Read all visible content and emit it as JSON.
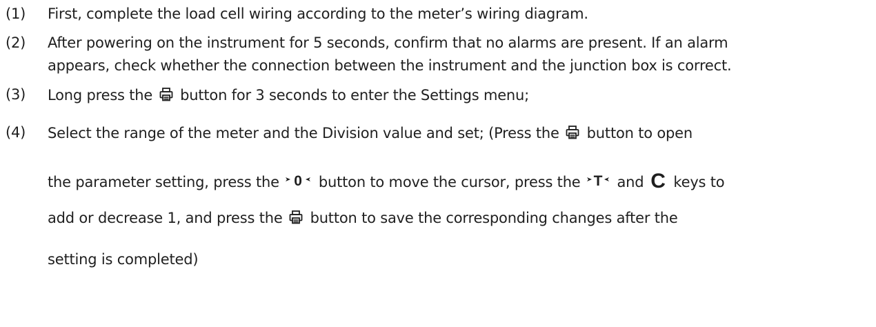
{
  "items": [
    {
      "number": "(1)",
      "text": "First, complete the load cell wiring according to the meter’s wiring diagram."
    },
    {
      "number": "(2)",
      "line1": "After powering on the instrument for 5 seconds, confirm that no alarms are present. If an alarm",
      "line2": "appears, check whether the connection between the instrument and the junction box is correct."
    },
    {
      "number": "(3)",
      "before": "Long press the",
      "after": "button for 3 seconds to enter the Settings menu;"
    },
    {
      "number": "(4)",
      "l1_a": "Select the range of the meter and the Division value and set;  (Press the",
      "l1_b": "button to open",
      "l2_a": "the parameter setting, press the",
      "l2_b": "button to move the cursor, press the",
      "l2_c": "and",
      "l2_d": "keys to",
      "l3_a": "add or decrease 1, and press the",
      "l3_b": "button to save the corresponding changes after the",
      "l4": "setting is completed)"
    }
  ],
  "icons": {
    "print": "print-key-icon",
    "zero": "zero-key-icon",
    "tare": "tare-key-icon",
    "clear": "c-key-icon",
    "zero_label": "0",
    "tare_label": "T",
    "clear_label": "C"
  }
}
